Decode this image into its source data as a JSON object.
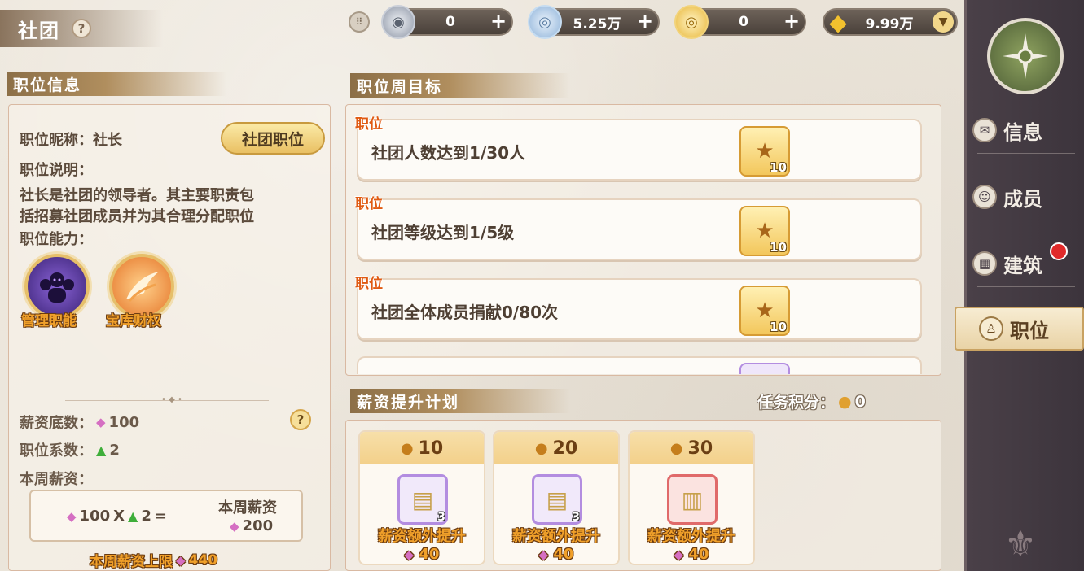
{
  "page": {
    "title": "社团"
  },
  "currencies": [
    {
      "icon": "medal-coin-icon",
      "value": "0",
      "color": "#8e96a6"
    },
    {
      "icon": "silver-coin-icon",
      "value": "5.25万",
      "color": "#8fb3d9"
    },
    {
      "icon": "gold-coin-icon",
      "value": "0",
      "color": "#e8b73b"
    },
    {
      "icon": "diamond-icon",
      "value": "9.99万",
      "color": "#f2c12e"
    }
  ],
  "left": {
    "section_title": "职位信息",
    "nickname_label": "职位昵称：社长",
    "club_position_button": "社团职位",
    "desc_label": "职位说明：",
    "desc_line1": "社长是社团的领导者。其主要职责包",
    "desc_line2": "括招募社团成员并为其合理分配职位",
    "ability_label": "职位能力：",
    "abilities": [
      {
        "icon": "management-icon",
        "label": "管理职能"
      },
      {
        "icon": "vault-wings-icon",
        "label": "宝库财权"
      }
    ],
    "salary_base_label": "薪资底数：",
    "salary_base_value": "100",
    "coefficient_label": "职位系数：",
    "coefficient_value": "2",
    "weekly_label": "本周薪资：",
    "formula_base": "100",
    "formula_x": "X",
    "formula_coef": "2",
    "formula_eq": "=",
    "box_title": "本周薪资",
    "box_value": "200",
    "cap_label": "本周薪资上限",
    "cap_value": "440"
  },
  "goals": {
    "section_title": "职位周目标",
    "items": [
      {
        "tag": "职位",
        "text": "社团人数达到1/30人",
        "reward": "10"
      },
      {
        "tag": "职位",
        "text": "社团等级达到1/5级",
        "reward": "10"
      },
      {
        "tag": "职位",
        "text": "社团全体成员捐献0/80次",
        "reward": "10"
      }
    ]
  },
  "plan": {
    "section_title": "薪资提升计划",
    "score_label": "任务积分：",
    "score_value": "0",
    "cards": [
      {
        "points": "10",
        "item_label": "薪资额外提升",
        "count": "3",
        "cost": "40",
        "style": "purple"
      },
      {
        "points": "20",
        "item_label": "薪资额外提升",
        "count": "3",
        "cost": "40",
        "style": "purple"
      },
      {
        "points": "30",
        "item_label": "薪资额外提升",
        "count": "",
        "cost": "40",
        "style": "red"
      }
    ]
  },
  "sidebar": {
    "items": [
      {
        "label": "信息",
        "icon": "chat-bubble-icon"
      },
      {
        "label": "成员",
        "icon": "members-icon"
      },
      {
        "label": "建筑",
        "icon": "building-icon"
      },
      {
        "label": "职位",
        "icon": "position-icon"
      }
    ],
    "active": "职位"
  }
}
